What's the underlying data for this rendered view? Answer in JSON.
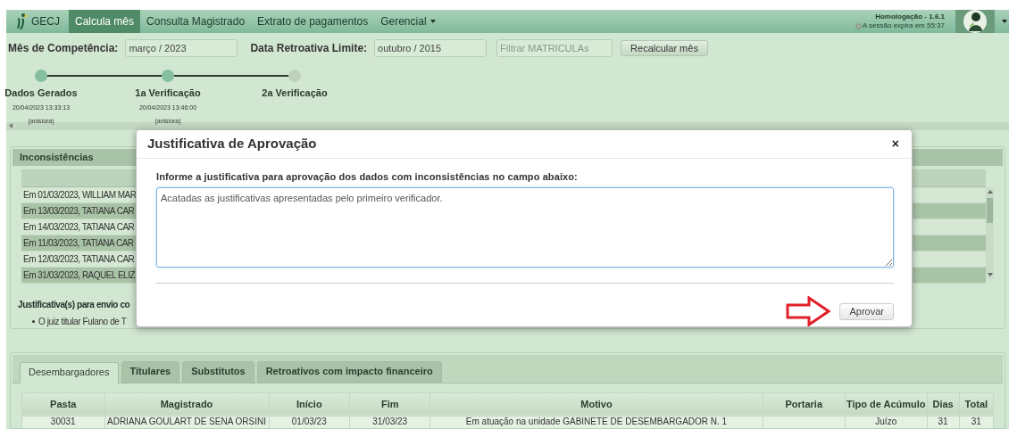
{
  "navbar": {
    "brand": "GECJ",
    "items": [
      {
        "label": "Calcula mês",
        "selected": true,
        "dropdown": false
      },
      {
        "label": "Consulta Magistrado",
        "selected": false,
        "dropdown": false
      },
      {
        "label": "Extrato de pagamentos",
        "selected": false,
        "dropdown": false
      },
      {
        "label": "Gerencial",
        "selected": false,
        "dropdown": true
      }
    ],
    "environment": "Homologação - 1.6.1",
    "session": "A sessão expira em 55:37"
  },
  "filters": {
    "month_label": "Mês de Competência:",
    "month_value": "março / 2023",
    "retro_label": "Data Retroativa Limite:",
    "retro_value": "outubro / 2015",
    "matriculas_placeholder": "Filtrar MATRICULAs",
    "recalc_button": "Recalcular mês"
  },
  "steps": [
    {
      "title": "Dados Gerados",
      "date": "20/04/2023 13:33:13",
      "user": "(anisiora)",
      "done": true
    },
    {
      "title": "1a Verificação",
      "date": "20/04/2023 13:46:00",
      "user": "(anisiora)",
      "done": true
    },
    {
      "title": "2a Verificação",
      "done": false
    }
  ],
  "inconsistencias": {
    "title": "Inconsistências",
    "rows": [
      "Em 01/03/2023, WILLIAM MAR",
      "Em 13/03/2023, TATIANA CAR",
      "Em 14/03/2023, TATIANA CAR",
      "Em 11/03/2023, TATIANA CAR",
      "Em 12/03/2023, TATIANA CAR",
      "Em 31/03/2023, RAQUEL ELIZ"
    ],
    "justification_heading": "Justificativa(s) para envio co",
    "justifications": [
      "O juiz titular Fulano de T"
    ]
  },
  "tabs": [
    {
      "label": "Desembargadores",
      "selected": true
    },
    {
      "label": "Titulares",
      "selected": false
    },
    {
      "label": "Substitutos",
      "selected": false
    },
    {
      "label": "Retroativos com impacto financeiro",
      "selected": false
    }
  ],
  "table": {
    "columns": [
      "Pasta",
      "Magistrado",
      "Início",
      "Fim",
      "Motivo",
      "Portaria",
      "Tipo de Acúmulo",
      "Dias",
      "Total"
    ],
    "rows": [
      [
        "30031",
        "ADRIANA GOULART DE SENA ORSINI",
        "01/03/23",
        "31/03/23",
        "Em atuação na unidade GABINETE DE DESEMBARGADOR N. 1",
        "",
        "Juízo",
        "31",
        "31"
      ]
    ]
  },
  "modal": {
    "title": "Justificativa de Aprovação",
    "close": "×",
    "label": "Informe a justificativa para aprovação dos dados com inconsistências no campo abaixo:",
    "value": "Acatadas as justificativas apresentadas pelo primeiro verificador.",
    "button": "Aprovar"
  }
}
